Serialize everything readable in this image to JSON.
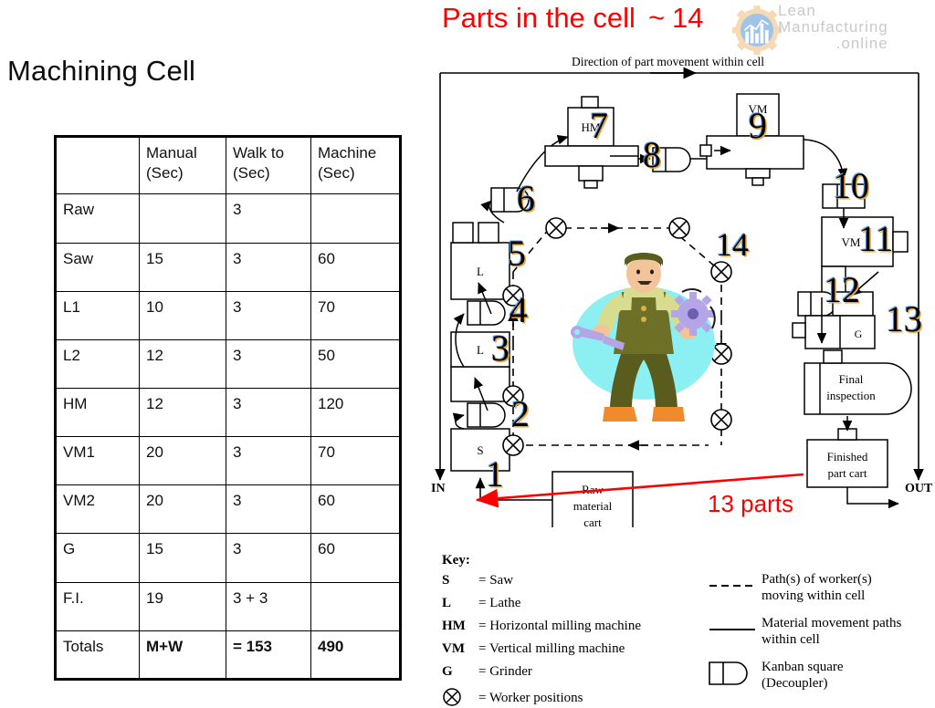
{
  "slide": {
    "title": "Machining Cell",
    "headline_text": "Parts in the cell",
    "headline_tilde": "~",
    "headline_count": "14",
    "red_annotation": "13 parts",
    "in_label": "IN",
    "out_label": "OUT",
    "direction_caption": "Direction of part movement within cell"
  },
  "logo": {
    "line1": "Lean",
    "line2": "Manufacturing",
    "line3": ".online",
    "icon": "gear-bar-chart-icon",
    "color": "#c9c9c9"
  },
  "table": {
    "name": "machining-cell-cycle-time-table",
    "headers": [
      "",
      "Manual\n(Sec)",
      "Walk to\n(Sec)",
      "Machine\n(Sec)"
    ],
    "header_cells": [
      {
        "line1": "",
        "line2": ""
      },
      {
        "line1": "Manual",
        "line2": "(Sec)"
      },
      {
        "line1": "Walk to",
        "line2": "(Sec)"
      },
      {
        "line1": "Machine",
        "line2": "(Sec)"
      }
    ],
    "rows": [
      {
        "station": "Raw",
        "manual": "",
        "walk": "3",
        "machine": ""
      },
      {
        "station": "Saw",
        "manual": "15",
        "walk": "3",
        "machine": "60"
      },
      {
        "station": "L1",
        "manual": "10",
        "walk": "3",
        "machine": "70"
      },
      {
        "station": "L2",
        "manual": "12",
        "walk": "3",
        "machine": "50"
      },
      {
        "station": "HM",
        "manual": "12",
        "walk": "3",
        "machine": "120"
      },
      {
        "station": "VM1",
        "manual": "20",
        "walk": "3",
        "machine": "70"
      },
      {
        "station": "VM2",
        "manual": "20",
        "walk": "3",
        "machine": "60"
      },
      {
        "station": "G",
        "manual": "15",
        "walk": "3",
        "machine": "60"
      },
      {
        "station": "F.I.",
        "manual": "19",
        "walk": "3 + 3",
        "machine": ""
      }
    ],
    "totals": {
      "station": "Totals",
      "manual": "M+W",
      "walk": "= 153",
      "machine": "490"
    }
  },
  "diagram": {
    "machine_labels": {
      "saw": "S",
      "lathe1": "L",
      "lathe2": "L",
      "horizontal_mill": "HM",
      "vertical_mill1": "VM",
      "vertical_mill2": "VM",
      "grinder": "G"
    },
    "boxes": {
      "raw_material_cart": [
        "Raw",
        "material",
        "cart"
      ],
      "final_inspection": [
        "Final",
        "inspection"
      ],
      "finished_part_cart": [
        "Finished",
        "part cart"
      ]
    },
    "kanban_numbers": [
      "1",
      "2",
      "3",
      "4",
      "5",
      "6",
      "7",
      "8",
      "9",
      "10",
      "11",
      "12",
      "13"
    ],
    "worker_count": "14"
  },
  "key": {
    "title": "Key:",
    "items": [
      {
        "code": "S",
        "eq": "= Saw"
      },
      {
        "code": "L",
        "eq": "= Lathe"
      },
      {
        "code": "HM",
        "eq": "= Horizontal milling machine"
      },
      {
        "code": "VM",
        "eq": "= Vertical milling machine"
      },
      {
        "code": "G",
        "eq": "= Grinder"
      },
      {
        "code": "",
        "eq": "= Worker positions",
        "icon": "worker-position-icon"
      }
    ],
    "legend": [
      {
        "symbol": "dashed-line-icon",
        "line1": "Path(s) of worker(s)",
        "line2": "moving within cell"
      },
      {
        "symbol": "solid-line-icon",
        "line1": "Material movement paths",
        "line2": "within cell"
      },
      {
        "symbol": "kanban-square-icon",
        "line1": "Kanban square",
        "line2": "(Decoupler)"
      }
    ]
  }
}
